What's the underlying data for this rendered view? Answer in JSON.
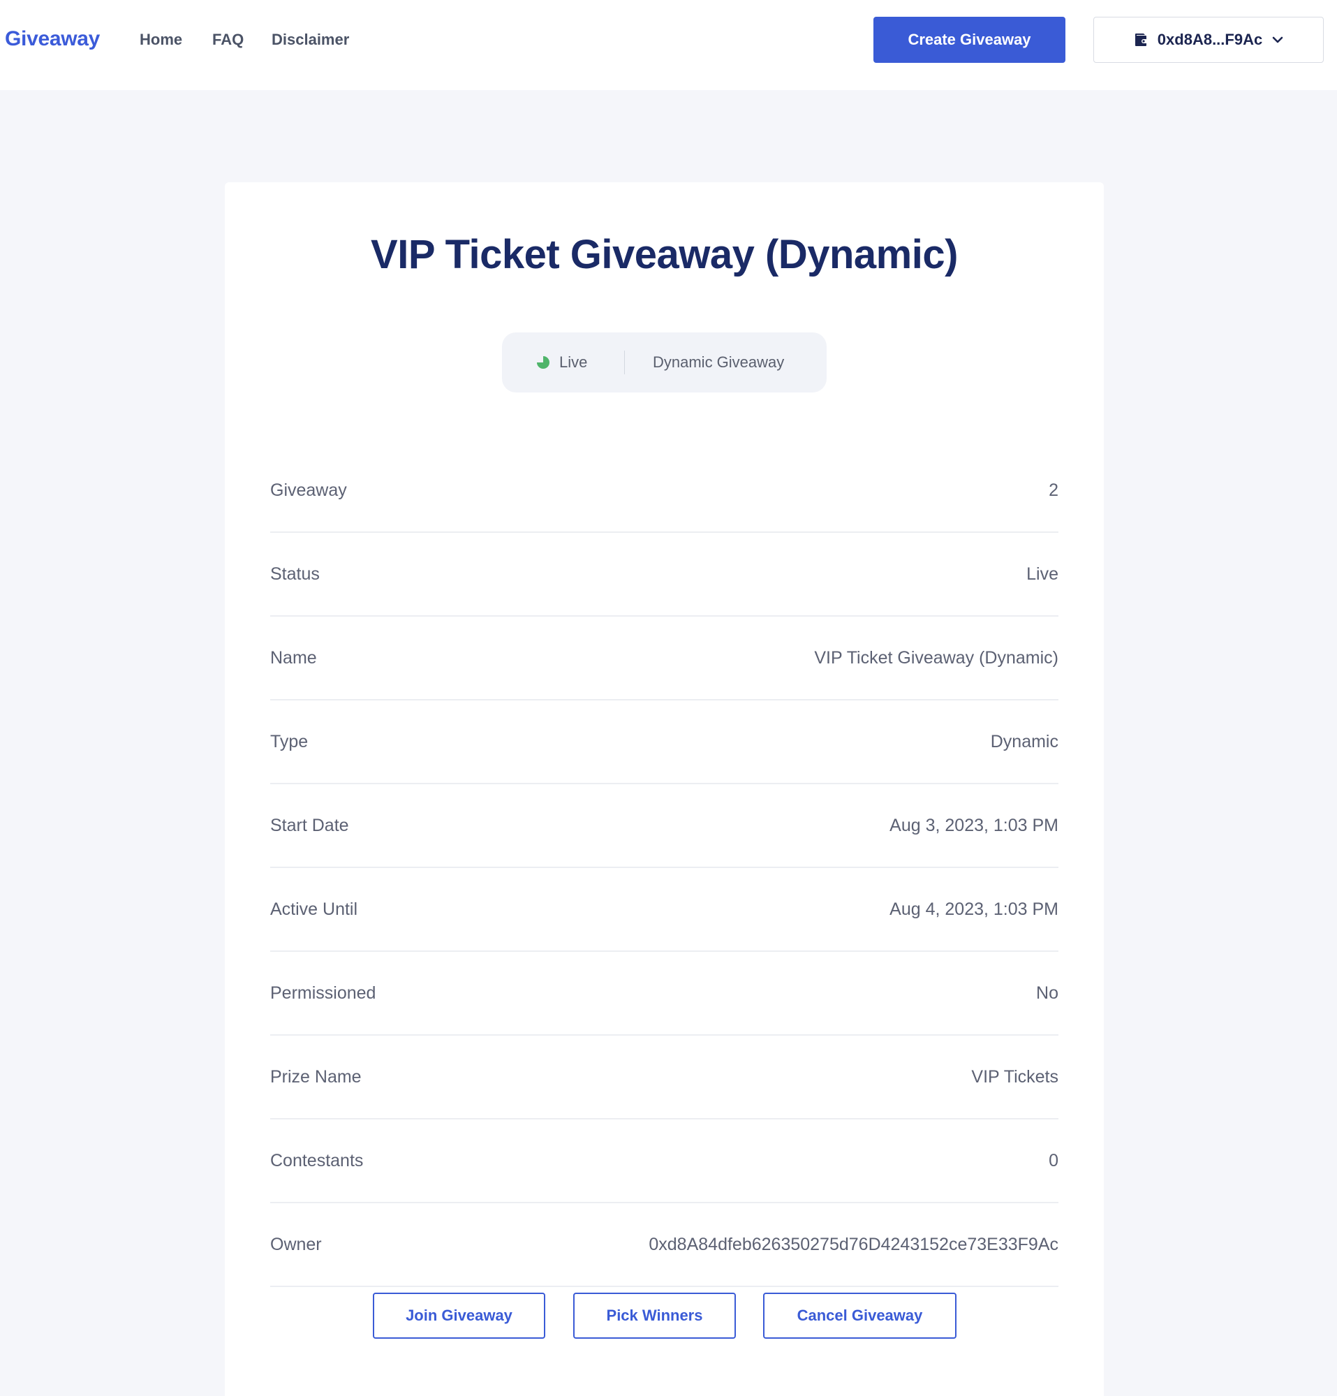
{
  "header": {
    "brand": "Giveaway",
    "nav": [
      "Home",
      "FAQ",
      "Disclaimer"
    ],
    "create_button": "Create Giveaway",
    "wallet_address": "0xd8A8...F9Ac"
  },
  "giveaway": {
    "title": "VIP Ticket Giveaway (Dynamic)",
    "status_pill": {
      "status": "Live",
      "type": "Dynamic Giveaway",
      "status_color": "#4fb46a"
    },
    "details": [
      {
        "label": "Giveaway",
        "value": "2"
      },
      {
        "label": "Status",
        "value": "Live"
      },
      {
        "label": "Name",
        "value": "VIP Ticket Giveaway (Dynamic)"
      },
      {
        "label": "Type",
        "value": "Dynamic"
      },
      {
        "label": "Start Date",
        "value": "Aug 3, 2023, 1:03 PM"
      },
      {
        "label": "Active Until",
        "value": "Aug 4, 2023, 1:03 PM"
      },
      {
        "label": "Permissioned",
        "value": "No"
      },
      {
        "label": "Prize Name",
        "value": "VIP Tickets"
      },
      {
        "label": "Contestants",
        "value": "0"
      },
      {
        "label": "Owner",
        "value": "0xd8A84dfeb626350275d76D4243152ce73E33F9Ac"
      }
    ],
    "actions": [
      "Join Giveaway",
      "Pick Winners",
      "Cancel Giveaway"
    ]
  },
  "colors": {
    "accent": "#3a5bd6",
    "title": "#1a2a66",
    "background": "#f5f6fa"
  },
  "icons": {
    "wallet": "wallet-icon",
    "chevron": "chevron-down-icon",
    "status": "status-dot-icon"
  }
}
